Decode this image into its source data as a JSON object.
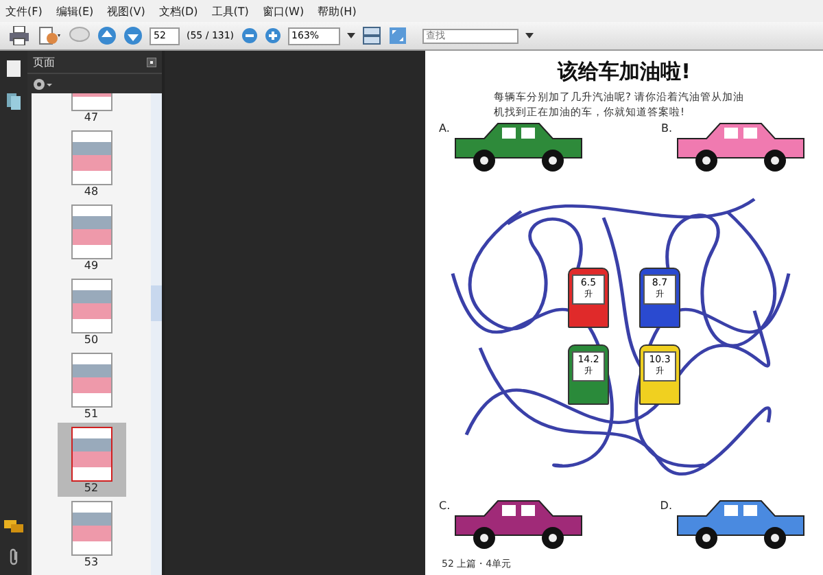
{
  "menu": [
    "文件(F)",
    "编辑(E)",
    "视图(V)",
    "文档(D)",
    "工具(T)",
    "窗口(W)",
    "帮助(H)"
  ],
  "toolbar": {
    "page_input": "52",
    "page_count": "(55 / 131)",
    "zoom": "163%",
    "search": {
      "placeholder": "查找"
    }
  },
  "panel": {
    "title": "页面",
    "thumbnails": [
      {
        "label": "47",
        "selected": false
      },
      {
        "label": "48",
        "selected": false
      },
      {
        "label": "49",
        "selected": false
      },
      {
        "label": "50",
        "selected": false
      },
      {
        "label": "51",
        "selected": false
      },
      {
        "label": "52",
        "selected": true
      },
      {
        "label": "53",
        "selected": false
      }
    ]
  },
  "document": {
    "title": "该给车加油啦!",
    "instructions": "每辆车分别加了几升汽油呢? 请你沿着汽油管从加油机找到正在加油的车，你就知道答案啦!",
    "cars": [
      {
        "label": "A.",
        "color": "#2e8a3a"
      },
      {
        "label": "B.",
        "color": "#f07ab0"
      },
      {
        "label": "C.",
        "color": "#a02a78"
      },
      {
        "label": "D.",
        "color": "#4a8ae0"
      }
    ],
    "pumps": [
      {
        "reading": "6.5",
        "unit": "升",
        "color": "#e02a2a"
      },
      {
        "reading": "8.7",
        "unit": "升",
        "color": "#2a4ad0"
      },
      {
        "reading": "14.2",
        "unit": "升",
        "color": "#2a8a3a"
      },
      {
        "reading": "10.3",
        "unit": "升",
        "color": "#f0d020"
      }
    ],
    "footer": "52  上篇・4单元"
  }
}
